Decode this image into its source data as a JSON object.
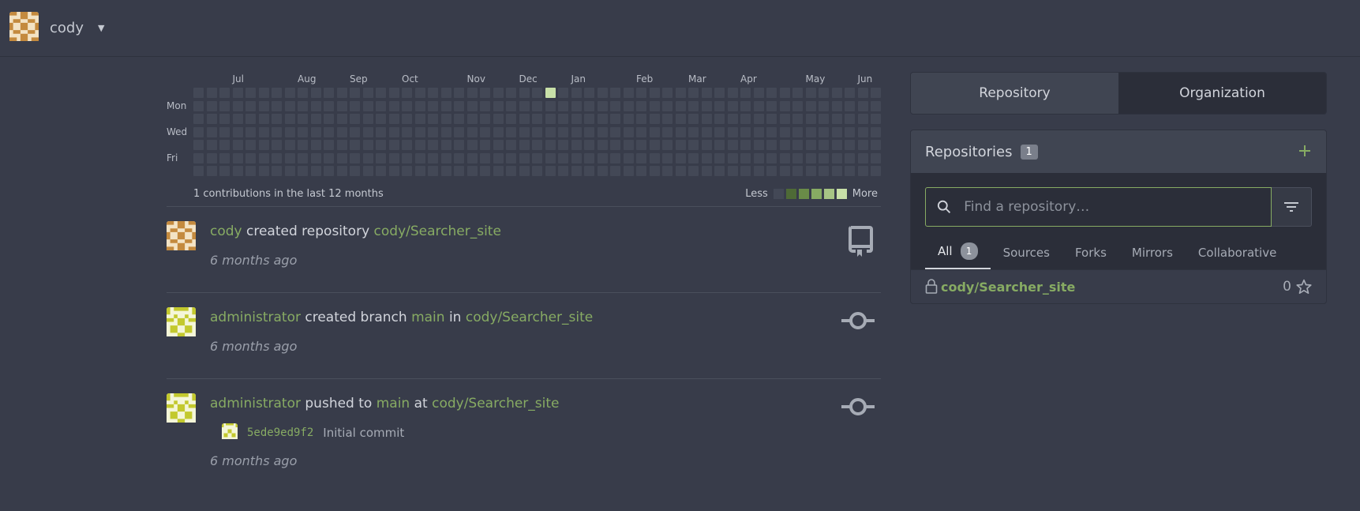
{
  "header": {
    "username": "cody"
  },
  "heatmap": {
    "months": [
      "Jul",
      "Aug",
      "Sep",
      "Oct",
      "Nov",
      "Dec",
      "Jan",
      "Feb",
      "Mar",
      "Apr",
      "May",
      "Jun"
    ],
    "days": [
      "Mon",
      "Wed",
      "Fri"
    ],
    "active_cells": [
      {
        "week": 27,
        "day": 0,
        "level": 1
      }
    ],
    "summary": "1 contributions in the last 12 months",
    "legend_less": "Less",
    "legend_more": "More",
    "legend_colors": [
      "#434856",
      "#4e6a36",
      "#6a8c48",
      "#87ab63",
      "#a7c585",
      "#c8e0a8"
    ]
  },
  "feed": [
    {
      "actor": "cody",
      "action": "created repository",
      "repo": "cody/Searcher_site",
      "time": "6 months ago",
      "icon": "repo-icon"
    },
    {
      "actor": "administrator",
      "action": "created branch",
      "branch": "main",
      "prep": "in",
      "repo": "cody/Searcher_site",
      "time": "6 months ago",
      "icon": "commit-icon"
    },
    {
      "actor": "administrator",
      "action": "pushed to",
      "branch": "main",
      "prep": "at",
      "repo": "cody/Searcher_site",
      "commit_sha": "5ede9ed9f2",
      "commit_msg": "Initial commit",
      "time": "6 months ago",
      "icon": "commit-icon"
    }
  ],
  "right": {
    "tabs": [
      "Repository",
      "Organization"
    ],
    "repos_title": "Repositories",
    "repos_count": "1",
    "search_placeholder": "Find a repository…",
    "subtabs": [
      "All",
      "Sources",
      "Forks",
      "Mirrors",
      "Collaborative"
    ],
    "all_count": "1",
    "repo_name": "cody/Searcher_site",
    "repo_stars": "0"
  }
}
